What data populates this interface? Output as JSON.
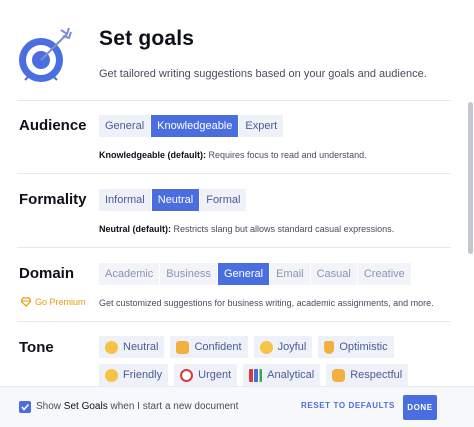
{
  "header": {
    "title": "Set goals",
    "subtitle": "Get tailored writing suggestions based on your goals and audience."
  },
  "audience": {
    "label": "Audience",
    "options": [
      "General",
      "Knowledgeable",
      "Expert"
    ],
    "selected": "Knowledgeable",
    "desc_bold": "Knowledgeable (default):",
    "desc_text": " Requires focus to read and understand."
  },
  "formality": {
    "label": "Formality",
    "options": [
      "Informal",
      "Neutral",
      "Formal"
    ],
    "selected": "Neutral",
    "desc_bold": "Neutral (default):",
    "desc_text": " Restricts slang but allows standard casual expressions."
  },
  "domain": {
    "label": "Domain",
    "options": [
      "Academic",
      "Business",
      "General",
      "Email",
      "Casual",
      "Creative"
    ],
    "selected": "General",
    "premium_label": "Go Premium",
    "desc_text": "Get customized suggestions for business writing, academic assignments, and more."
  },
  "tone": {
    "label": "Tone",
    "row1": [
      {
        "label": "Neutral",
        "icon": "neutral-face-icon"
      },
      {
        "label": "Confident",
        "icon": "handshake-icon"
      },
      {
        "label": "Joyful",
        "icon": "smiling-face-icon"
      },
      {
        "label": "Optimistic",
        "icon": "victory-hand-icon"
      }
    ],
    "row2": [
      {
        "label": "Friendly",
        "icon": "hugging-face-icon"
      },
      {
        "label": "Urgent",
        "icon": "alarm-clock-icon"
      },
      {
        "label": "Analytical",
        "icon": "bar-chart-icon"
      },
      {
        "label": "Respectful",
        "icon": "raised-hands-icon"
      }
    ]
  },
  "footer": {
    "checkbox_checked": true,
    "show_text_pre": "Show ",
    "show_text_bold": "Set Goals",
    "show_text_post": " when I start a new document",
    "reset_label": "RESET TO DEFAULTS",
    "done_label": "DONE"
  },
  "colors": {
    "accent": "#4a6ee0",
    "pill_bg": "#eff1f8",
    "pill_text": "#4a5b96",
    "premium": "#e89c0a"
  }
}
